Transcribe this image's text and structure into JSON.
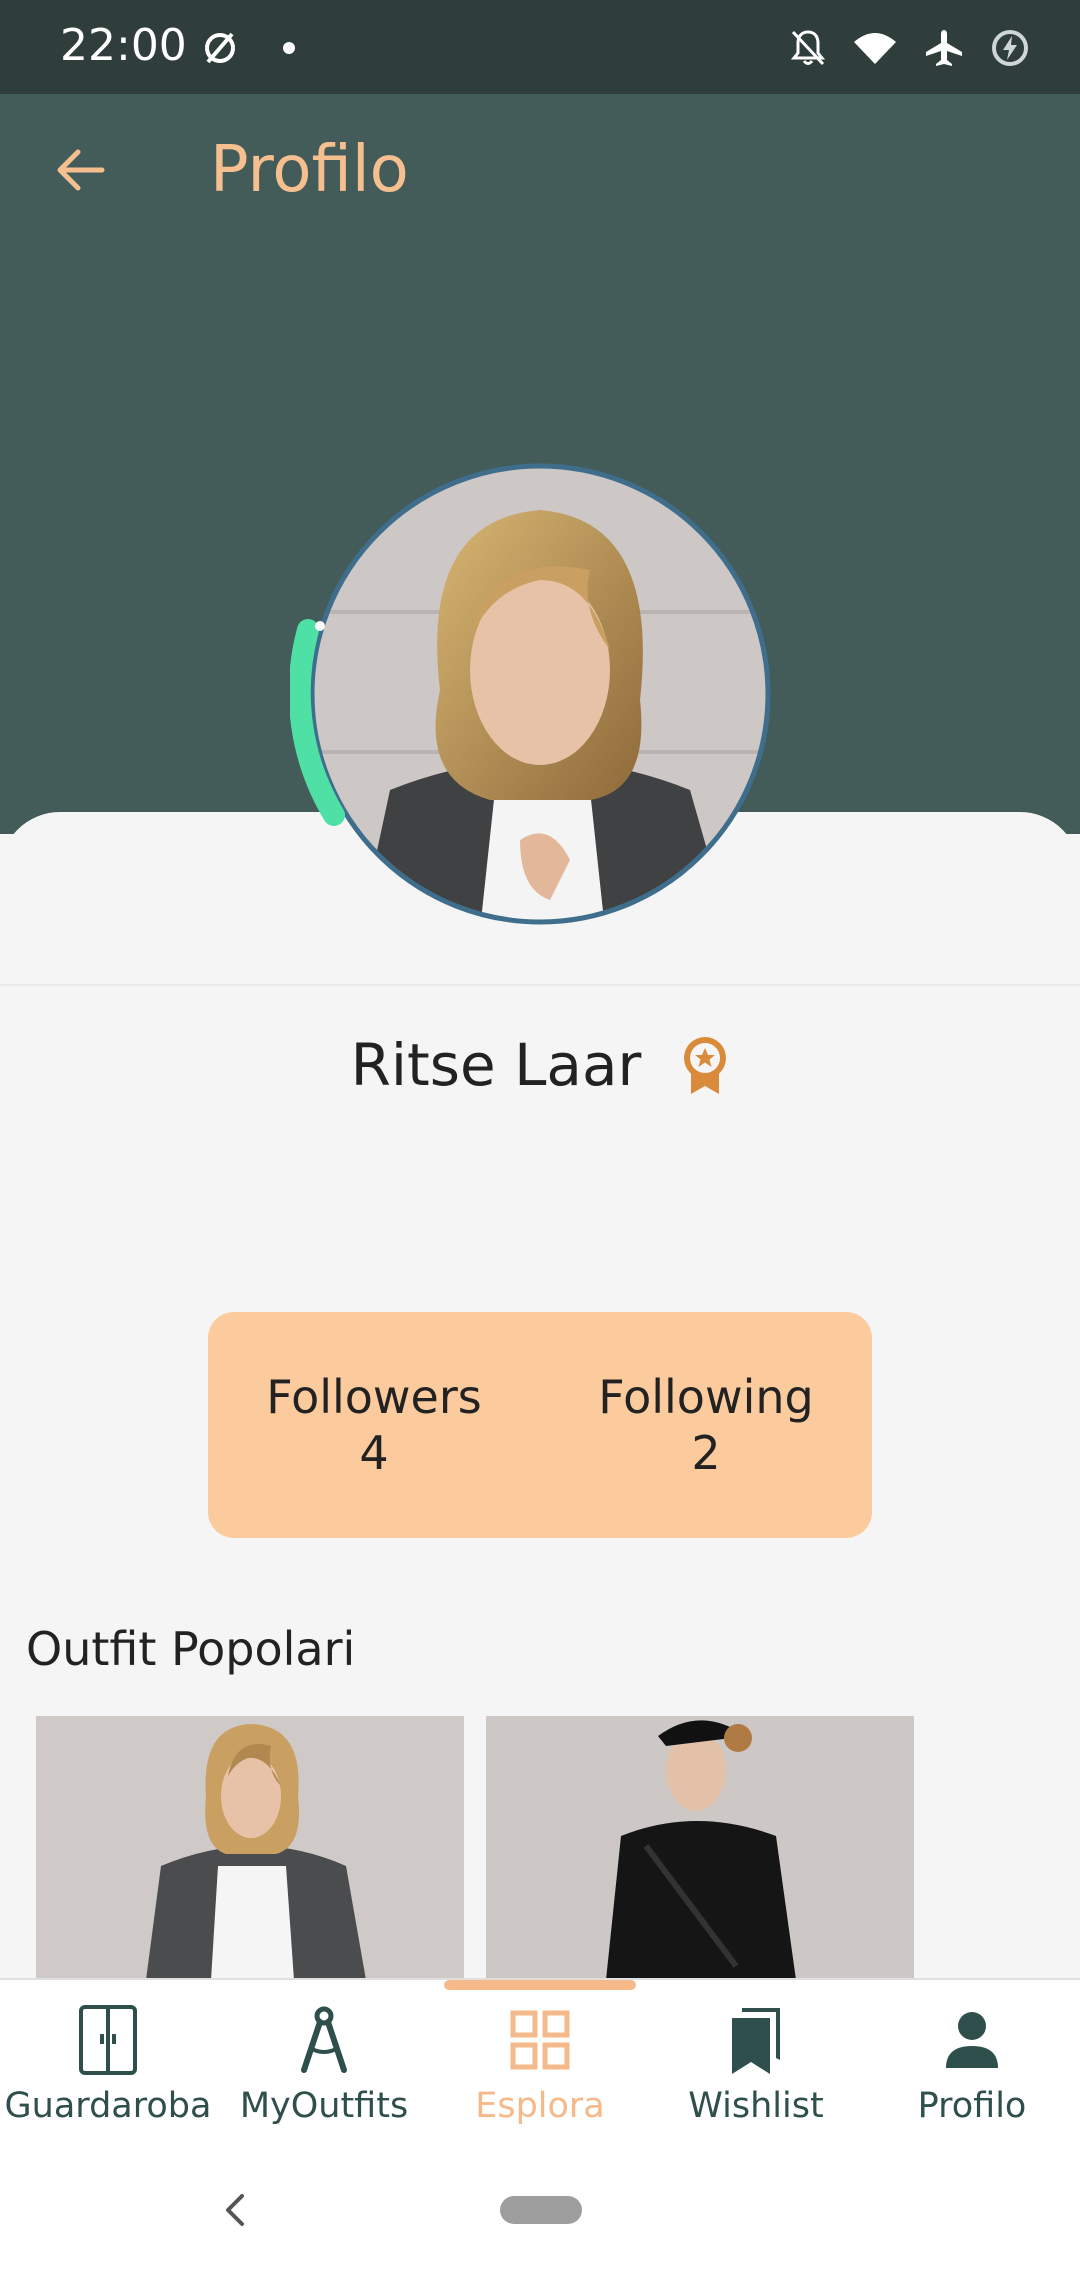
{
  "status_bar": {
    "time": "22:00",
    "icons": [
      "data-saver-icon",
      "dot-icon",
      "notifications-off-icon",
      "wifi-icon",
      "airplane-icon",
      "battery-charging-icon"
    ]
  },
  "header": {
    "title": "Profilo",
    "back_icon": "arrow-back-icon",
    "background_color": "#435c59",
    "title_color": "#f6bf8f"
  },
  "profile": {
    "name": "Ritse Laar",
    "badge_icon": "award-ribbon-icon",
    "level_progress_ring_color": "#4fe0a6"
  },
  "stats": {
    "followers_label": "Followers",
    "followers_count": "4",
    "following_label": "Following",
    "following_count": "2"
  },
  "popular_outfits": {
    "title": "Outfit Popolari"
  },
  "bottom_nav": {
    "items": [
      {
        "label": "Guardaroba",
        "icon": "wardrobe-icon"
      },
      {
        "label": "MyOutfits",
        "icon": "compass-drafting-icon"
      },
      {
        "label": "Esplora",
        "icon": "grid-icon"
      },
      {
        "label": "Wishlist",
        "icon": "bookmarks-icon"
      },
      {
        "label": "Profilo",
        "icon": "person-icon"
      }
    ],
    "active": "Esplora",
    "active_color": "#f6b98a"
  }
}
